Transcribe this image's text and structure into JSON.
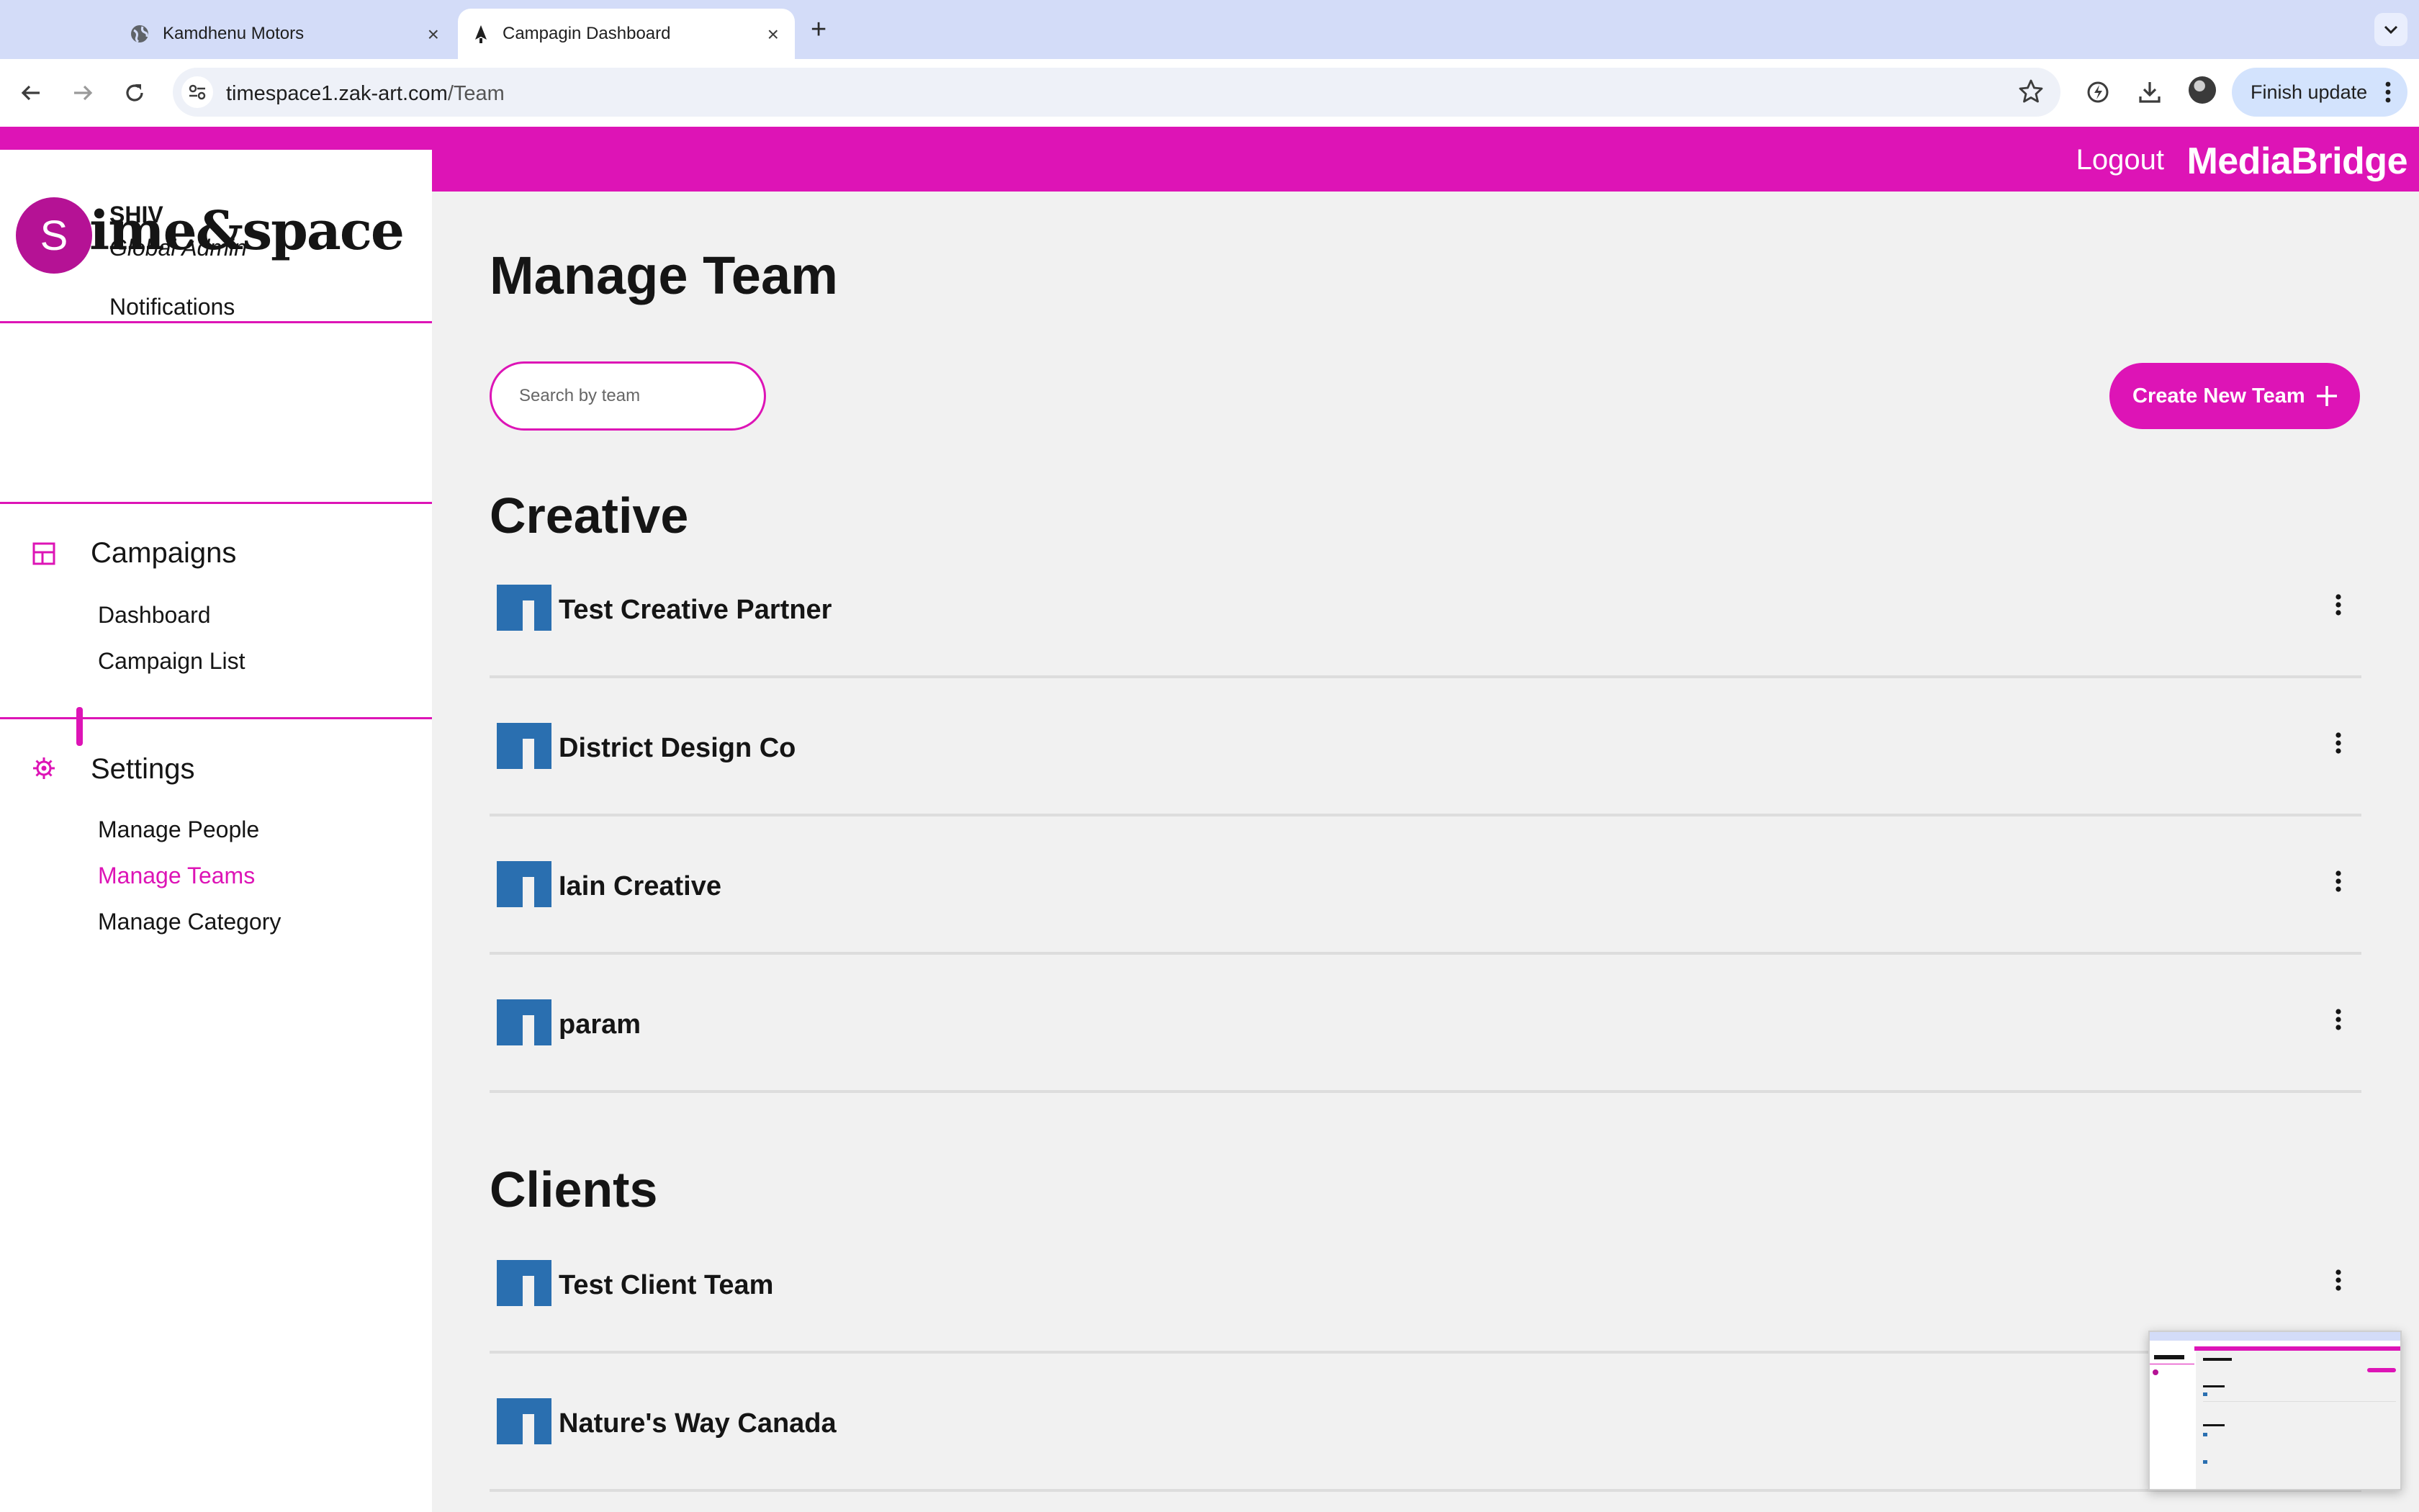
{
  "browser": {
    "tabs": [
      {
        "title": "Kamdhenu Motors",
        "icon": "globe-icon",
        "active": false
      },
      {
        "title": "Campagin Dashboard",
        "icon": "tab-favicon-icon",
        "active": true
      }
    ],
    "url_host": "timespace1.zak-art.com",
    "url_path": "/Team",
    "finish_update_label": "Finish update"
  },
  "header": {
    "logout_label": "Logout",
    "brand": "MediaBridge",
    "accent_color": "#dd14b6"
  },
  "sidebar": {
    "logo_text": "time&space",
    "user": {
      "initial": "S",
      "name": "SHIV",
      "role": "Global Admin"
    },
    "notifications_label": "Notifications",
    "sections": [
      {
        "title": "Campaigns",
        "icon": "layout-grid-icon",
        "items": [
          "Dashboard",
          "Campaign List"
        ]
      },
      {
        "title": "Settings",
        "icon": "gear-icon",
        "items": [
          "Manage People",
          "Manage Teams",
          "Manage Category"
        ],
        "active_item": "Manage Teams"
      }
    ]
  },
  "main": {
    "page_title": "Manage Team",
    "search_placeholder": "Search by team",
    "create_button_label": "Create New Team",
    "groups": [
      {
        "title": "Creative",
        "teams": [
          "Test Creative Partner",
          "District Design Co",
          "Iain Creative",
          "param"
        ]
      },
      {
        "title": "Clients",
        "teams": [
          "Test Client Team",
          "Nature's Way Canada"
        ]
      }
    ],
    "team_logo_color": "#2a6fb0"
  }
}
